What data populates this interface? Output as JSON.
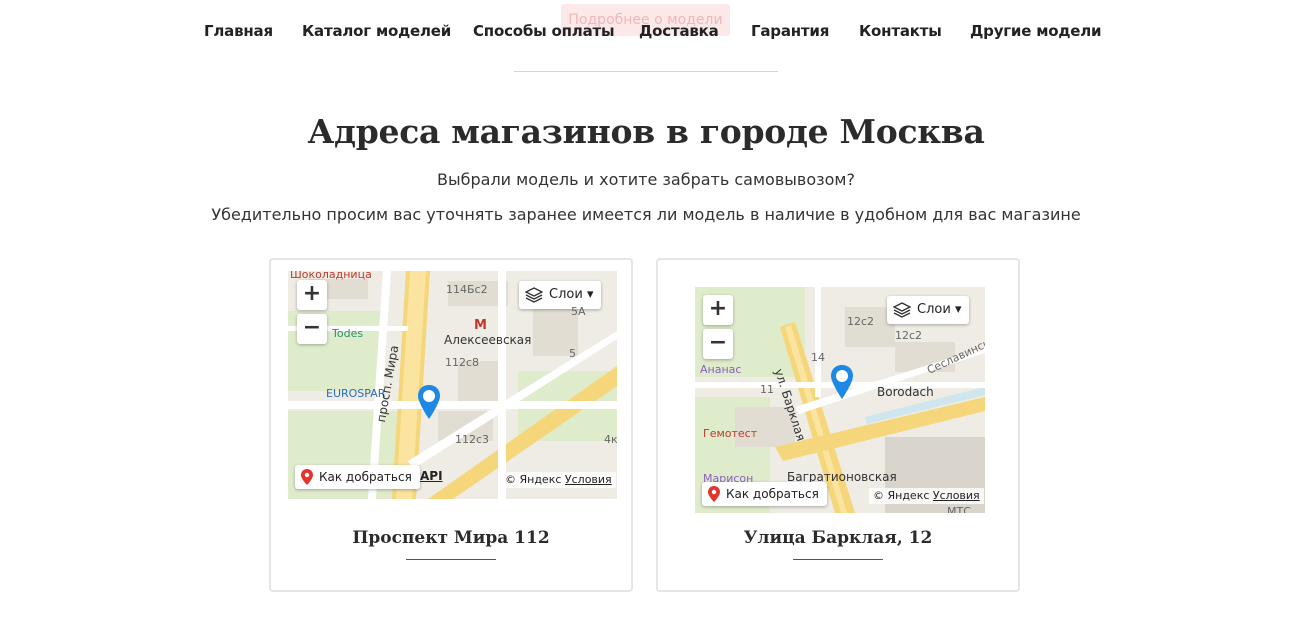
{
  "ghost_button": "Подробнее о модели",
  "nav": {
    "items": [
      "Главная",
      "Каталог моделей",
      "Способы оплаты",
      "Доставка",
      "Гарантия",
      "Контакты",
      "Другие модели"
    ]
  },
  "main": {
    "title": "Адреса магазинов в городе Москва",
    "subtitle1": "Выбрали модель и хотите забрать самовывозом?",
    "subtitle2": "Убедительно просим вас уточнять заранее имеется ли модель в наличие в удобном для вас магазине"
  },
  "map_common": {
    "zoom_in": "+",
    "zoom_out": "−",
    "layers": "Слои",
    "route": "Как добраться",
    "copyright": "© Яндекс",
    "terms": "Условия",
    "api": "API"
  },
  "stores": [
    {
      "title": "Проспект Мира 112",
      "map_labels": [
        "Шоколадница",
        "114Бс2",
        "5А",
        "Todes",
        "Алексеевская",
        "112с8",
        "5",
        "EUROSPAR",
        "просп. Мира",
        "112с3",
        "4к",
        "М"
      ]
    },
    {
      "title": "Улица Барклая, 12",
      "map_labels": [
        "12с2",
        "12с2",
        "14",
        "Ананас",
        "11",
        "ул. Барклая",
        "Borodach",
        "Сеславинская",
        "Гемотест",
        "Багратионовская",
        "Марисон",
        "МТС"
      ]
    }
  ],
  "colors": {
    "accent": "#c0262c",
    "metro": "#e4352c",
    "pin": "#1e88e5"
  }
}
